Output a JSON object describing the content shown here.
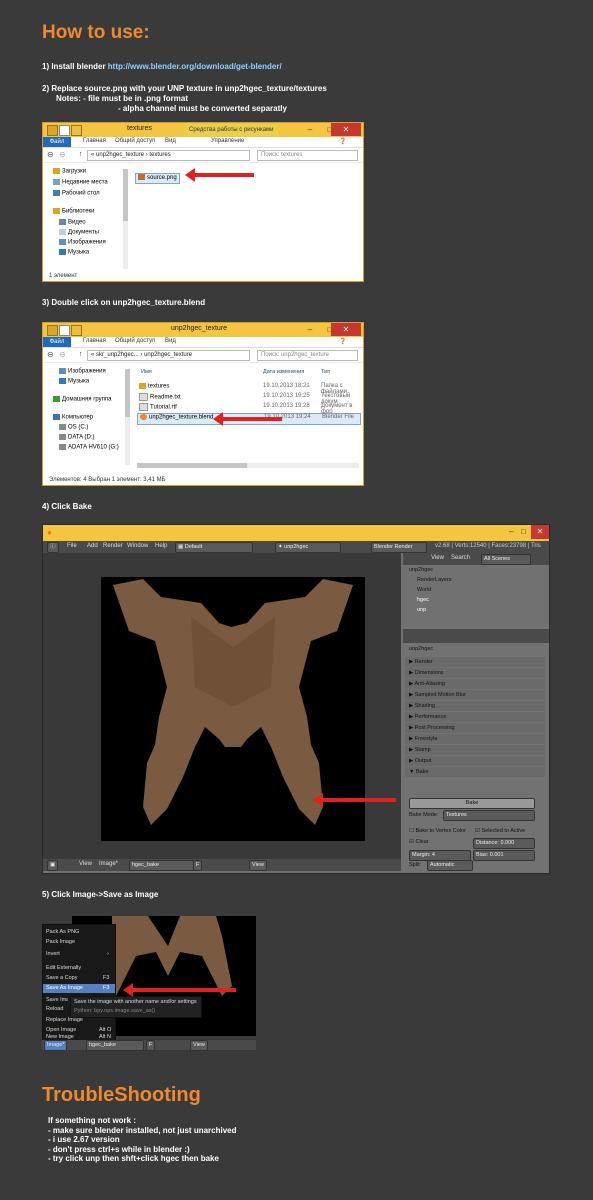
{
  "header": {
    "title": "How to use:"
  },
  "steps": {
    "s1_prefix": "1) Install blender ",
    "s1_link": "http://www.blender.org/download/get-blender/",
    "s2": "2) Replace source.png with your UNP texture in unp2hgec_texture/textures",
    "s2_note1": "Notes: - file must be in .png format",
    "s2_note2": "- alpha channel must be converted separatly",
    "s3": "3) Double click on unp2hgec_texture.blend",
    "s4": "4) Click Bake",
    "s5": "5) Click Image->Save as Image"
  },
  "win1": {
    "title": "textures",
    "context_tab": "Средства работы с рисунками",
    "ribbon": [
      "Файл",
      "Главная",
      "Общий доступ",
      "Вид",
      "Управление"
    ],
    "path": [
      "unp2hgec_texture",
      "textures"
    ],
    "search_placeholder": "Поиск: textures",
    "nav": [
      "Загрузки",
      "Недавние места",
      "Рабочий стол",
      "Библиотеки",
      "Видео",
      "Документы",
      "Изображения",
      "Музыка"
    ],
    "file": "source.png",
    "status": "1 элемент"
  },
  "win2": {
    "title": "unp2hgec_texture",
    "ribbon": [
      "Файл",
      "Главная",
      "Общий доступ",
      "Вид"
    ],
    "path": [
      "skr_unp2hgec...",
      "unp2hgec_texture"
    ],
    "search_placeholder": "Поиск: unp2hgec_texture",
    "nav": [
      "Изображения",
      "Музыка",
      "Домашняя группа",
      "Компьютер",
      "OS (C:)",
      "DATA (D:)",
      "ADATA HV610 (G:)"
    ],
    "columns": [
      "Имя",
      "Дата изменения",
      "Тип"
    ],
    "rows": [
      {
        "name": "textures",
        "date": "19.10.2013 18:21",
        "type": "Папка с файлами"
      },
      {
        "name": "Readme.txt",
        "date": "19.10.2013 19:25",
        "type": "Текстовый докум"
      },
      {
        "name": "Tutorial.rtf",
        "date": "19.10.2013 19:28",
        "type": "Документ в фор"
      },
      {
        "name": "unp2hgec_texture.blend",
        "date": "19.10.2013 19:24",
        "type": "Blender File"
      }
    ],
    "status": "Элементов: 4    Выбран 1 элемент: 3,41 МБ"
  },
  "blender": {
    "menus": [
      "File",
      "Add",
      "Render",
      "Window",
      "Help"
    ],
    "layout": "Default",
    "scene": "unp2hgec",
    "engine": "Blender Render",
    "info": "v2.68 | Verts:12540 | Faces:23798 | Tris",
    "outliner": {
      "view": "View",
      "search": "Search",
      "filter": "All Scenes",
      "items": [
        "unp2hgec",
        "RenderLayers",
        "World",
        "hgec",
        "unp"
      ]
    },
    "props": {
      "scene": "unp2hgec",
      "panels": [
        "Render",
        "Dimensions",
        "Anti-Aliasing",
        "Sampled Motion Blur",
        "Shading",
        "Performance",
        "Post Processing",
        "Freestyle",
        "Stamp",
        "Output",
        "Bake"
      ],
      "bake_button": "Bake",
      "bake_mode_label": "Bake Mode:",
      "bake_mode": "Textures",
      "bake_to_vertex": "Bake to Vertex Color",
      "selected_to_active": "Selected to Active",
      "clear": "Clear",
      "distance": "Distance: 0.000",
      "margin": "Margin: 4",
      "bias": "Bias: 0.001",
      "split_label": "Split:",
      "split": "Automatic"
    },
    "image_header": {
      "view": "View",
      "image": "Image*",
      "name": "hgec_bake",
      "f": "F",
      "view2": "View"
    }
  },
  "image_menu": {
    "items": [
      "Pack As PNG",
      "Pack Image",
      "Invert",
      "Edit Externally",
      "Save a Copy",
      "Save As Image",
      "Save Image",
      "Reload",
      "Replace Image",
      "Open Image",
      "New Image"
    ],
    "shortcuts": {
      "save_copy": "F3",
      "save_as": "F3",
      "open": "Alt O",
      "new": "Alt N"
    },
    "tooltip": "Save the image with another name and/or settings",
    "tooltip_py": "Python: bpy.ops.image.save_as()",
    "header_image": "Image*",
    "header_name": "hgec_bake",
    "header_f": "F",
    "header_view": "View"
  },
  "trouble": {
    "title": "TroubleShooting",
    "lines": [
      "If something not work :",
      "- make sure blender installed, not just unarchived",
      "- i use 2.67 version",
      "- don't press ctrl+s while in blender :)",
      "- try click unp then shft+click hgec then bake"
    ]
  },
  "colors": {
    "accent": "#ef8a2c",
    "link": "#8fd0ff",
    "arrow": "#e0211c",
    "explorer_title": "#f3c540",
    "skin": "#7a5a40"
  }
}
